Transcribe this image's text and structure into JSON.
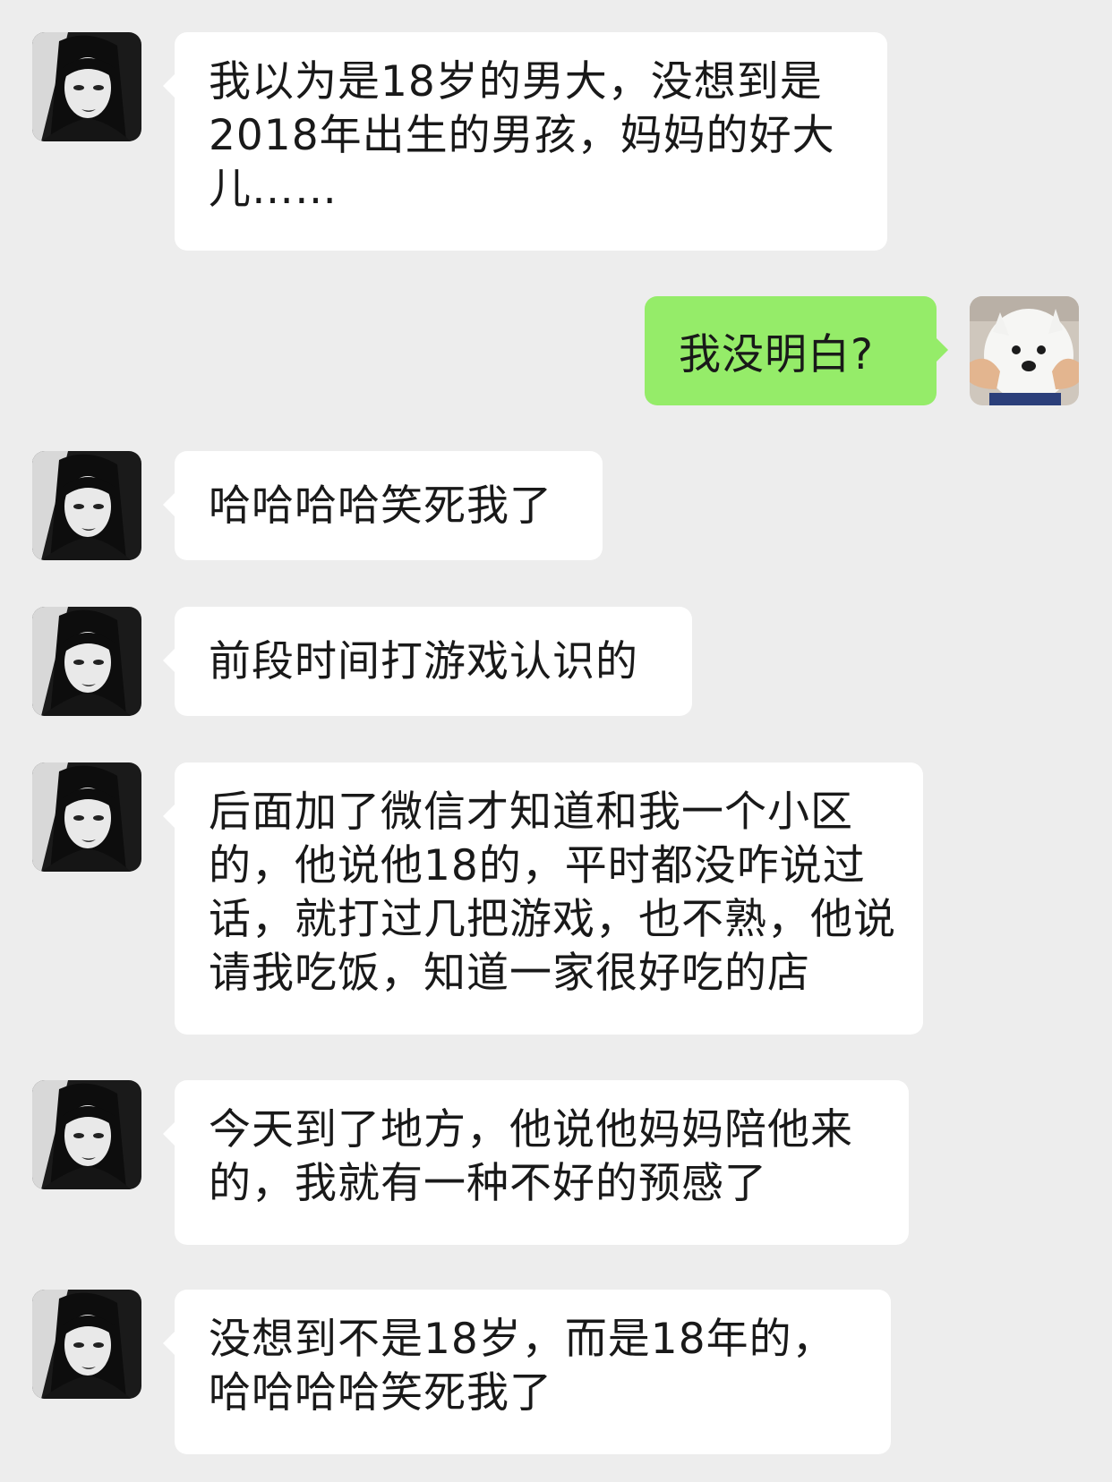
{
  "contact_avatar_icon": "woman-portrait-avatar",
  "self_avatar_icon": "white-dog-avatar",
  "colors": {
    "background": "#EDEDED",
    "incoming_bubble": "#FFFFFF",
    "outgoing_bubble": "#95EC69",
    "text": "#191919"
  },
  "messages": [
    {
      "from": "contact",
      "text": "我以为是18岁的男大，没想到是2018年出生的男孩，妈妈的好大儿……"
    },
    {
      "from": "self",
      "text": "我没明白?"
    },
    {
      "from": "contact",
      "text": "哈哈哈哈笑死我了"
    },
    {
      "from": "contact",
      "text": "前段时间打游戏认识的"
    },
    {
      "from": "contact",
      "text": "后面加了微信才知道和我一个小区的，他说他18的，平时都没咋说过话，就打过几把游戏，也不熟，他说请我吃饭，知道一家很好吃的店"
    },
    {
      "from": "contact",
      "text": "今天到了地方，他说他妈妈陪他来的，我就有一种不好的预感了"
    },
    {
      "from": "contact",
      "text": "没想到不是18岁，而是18年的，哈哈哈哈笑死我了"
    }
  ]
}
